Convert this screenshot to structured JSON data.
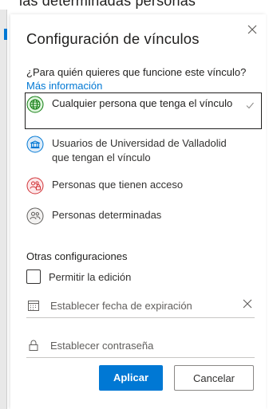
{
  "background_text": "las determinadas personas",
  "dialog": {
    "title": "Configuración de vínculos",
    "question": "¿Para quién quieres que funcione este vínculo?",
    "more_info_link": "Más información"
  },
  "options": [
    {
      "label": "Cualquier persona que tenga el vínculo",
      "icon": "globe-icon",
      "icon_color": "#107c10",
      "icon_bg": "#dff6dd",
      "selected": true
    },
    {
      "label": "Usuarios de Universidad de Valladolid que tengan el vínculo",
      "icon": "building-icon",
      "icon_color": "#0078d4",
      "icon_bg": "#deecf9",
      "selected": false
    },
    {
      "label": "Personas que tienen acceso",
      "icon": "people-lock-icon",
      "icon_color": "#d13438",
      "icon_bg": "#fde7e9",
      "selected": false
    },
    {
      "label": "Personas determinadas",
      "icon": "people-icon",
      "icon_color": "#605e5c",
      "icon_bg": "#f3f2f1",
      "selected": false
    }
  ],
  "other_settings": {
    "title": "Otras configuraciones",
    "allow_edit_label": "Permitir la edición",
    "allow_edit_checked": false,
    "expiration_placeholder": "Establecer fecha de expiración",
    "password_placeholder": "Establecer contraseña"
  },
  "buttons": {
    "apply": "Aplicar",
    "cancel": "Cancelar"
  },
  "colors": {
    "accent": "#0078d4",
    "text": "#323130"
  }
}
